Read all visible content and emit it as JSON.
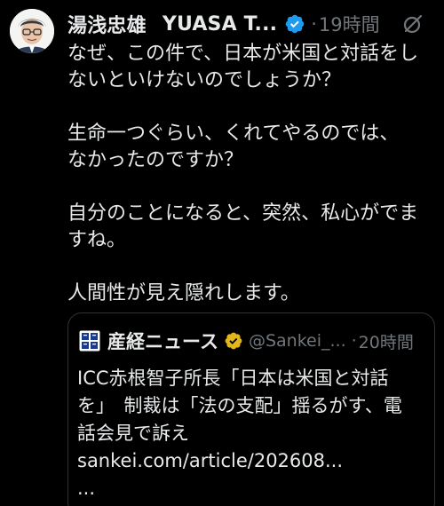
{
  "author": {
    "display_name": "湯浅忠雄",
    "handle_partial": "YUASA T...",
    "timestamp": "19時間",
    "separator": "·"
  },
  "icons": {
    "verified": "verified-badge-icon",
    "grok": "grok-slash-icon",
    "gold_badge": "gold-verified-badge-icon"
  },
  "colors": {
    "verified_blue": "#1d9bf0",
    "gold": "#e2b719",
    "muted": "#71767b",
    "text": "#e7e9ea",
    "background": "#000000"
  },
  "tweet": {
    "paragraphs": [
      "なぜ、この件で、日本が米国と対話をし\nないといけないのでしょうか？",
      "生命一つぐらい、くれてやるのでは、\nなかったのですか？",
      "自分のことになると、突然、私心がでま\nすね。",
      "人間性が見え隠れします。"
    ]
  },
  "quote": {
    "source_name": "産経ニュース",
    "handle": "@Sankei_...",
    "separator": "·",
    "timestamp": "20時間",
    "lines": [
      "ICC赤根智子所長「日本は米国と対話",
      "を」　制裁は「法の支配」揺るがす、電",
      "話会見で訴え",
      "sankei.com/article/202608...",
      "..."
    ]
  }
}
